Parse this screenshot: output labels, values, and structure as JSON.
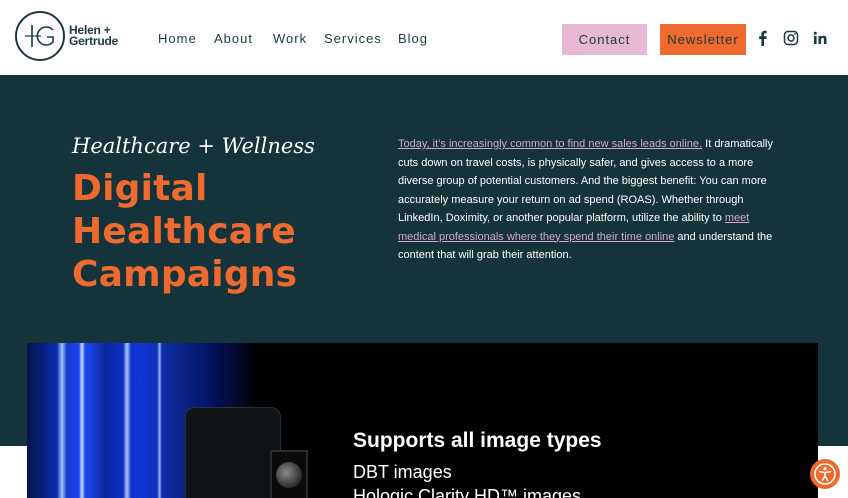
{
  "header": {
    "logo": {
      "monogram": "HG",
      "line1": "Helen +",
      "line2": "Gertrude"
    },
    "nav": {
      "items": [
        "Home",
        "About",
        "Work",
        "Services",
        "Blog"
      ]
    },
    "contact_label": "Contact",
    "newsletter_label": "Newsletter",
    "social": [
      "facebook-icon",
      "instagram-icon",
      "linkedin-icon"
    ],
    "colors": {
      "dark_teal": "#14333a",
      "orange": "#ee6a2e",
      "pink": "#e6b8d6"
    }
  },
  "hero": {
    "subtitle": "Healthcare + Wellness",
    "title_lines": [
      "Digital",
      "Healthcare",
      "Campaigns"
    ],
    "paragraph": {
      "link1": "Today, it’s increasingly common to find new sales leads online.",
      "text1": " It dramatically cuts down on travel costs, is physically safer, and gives access to a more diverse group of potential customers. And the biggest benefit: You can more accurately measure your return on ad spend (ROAS). Whether through LinkedIn, Doximity, or another popular platform, utilize the ability to ",
      "link2": "meet medical professionals where they spend their time online",
      "text2": " and understand the content that will grab their attention."
    }
  },
  "media": {
    "heading": "Supports all image types",
    "line1": "DBT images",
    "line2": "Hologic Clarity HD™ images"
  }
}
